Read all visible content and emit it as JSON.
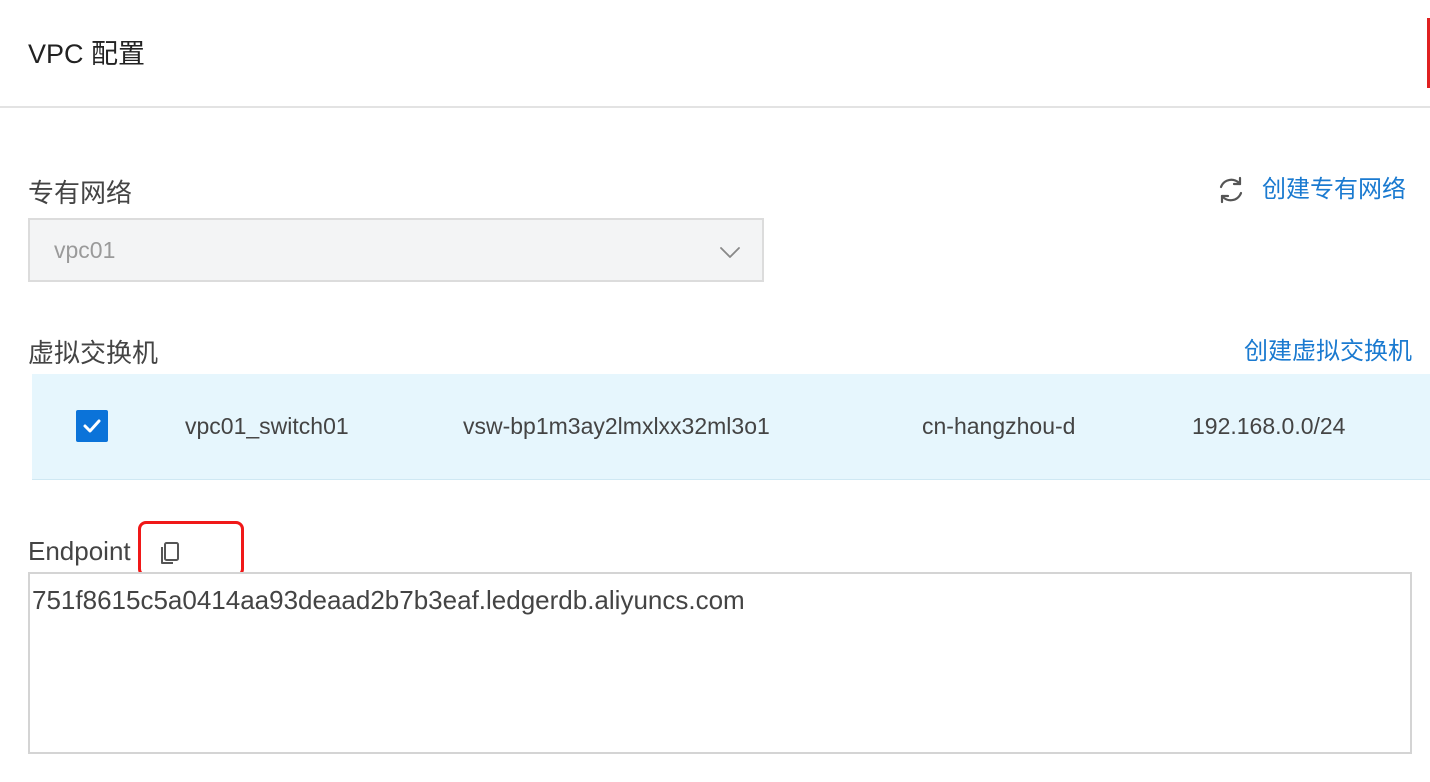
{
  "header": {
    "title": "VPC 配置"
  },
  "vpc": {
    "label": "专有网络",
    "selected_value": "vpc01",
    "create_link": "创建专有网络",
    "refresh_icon": "refresh-icon",
    "chevron_icon": "chevron-down-icon"
  },
  "vswitch": {
    "label": "虚拟交换机",
    "create_link": "创建虚拟交换机",
    "rows": [
      {
        "checked": true,
        "name": "vpc01_switch01",
        "id": "vsw-bp1m3ay2lmxlxx32ml3o1",
        "zone": "cn-hangzhou-d",
        "cidr": "192.168.0.0/24"
      }
    ]
  },
  "endpoint": {
    "label": "Endpoint",
    "value": "751f8615c5a0414aa93deaad2b7b3eaf.ledgerdb.aliyuncs.com",
    "copy_icon": "copy-icon"
  },
  "colors": {
    "link": "#1a7ad0",
    "checkbox": "#0b73d9",
    "row_highlight": "#e6f6fd",
    "annotation": "#f01818"
  }
}
